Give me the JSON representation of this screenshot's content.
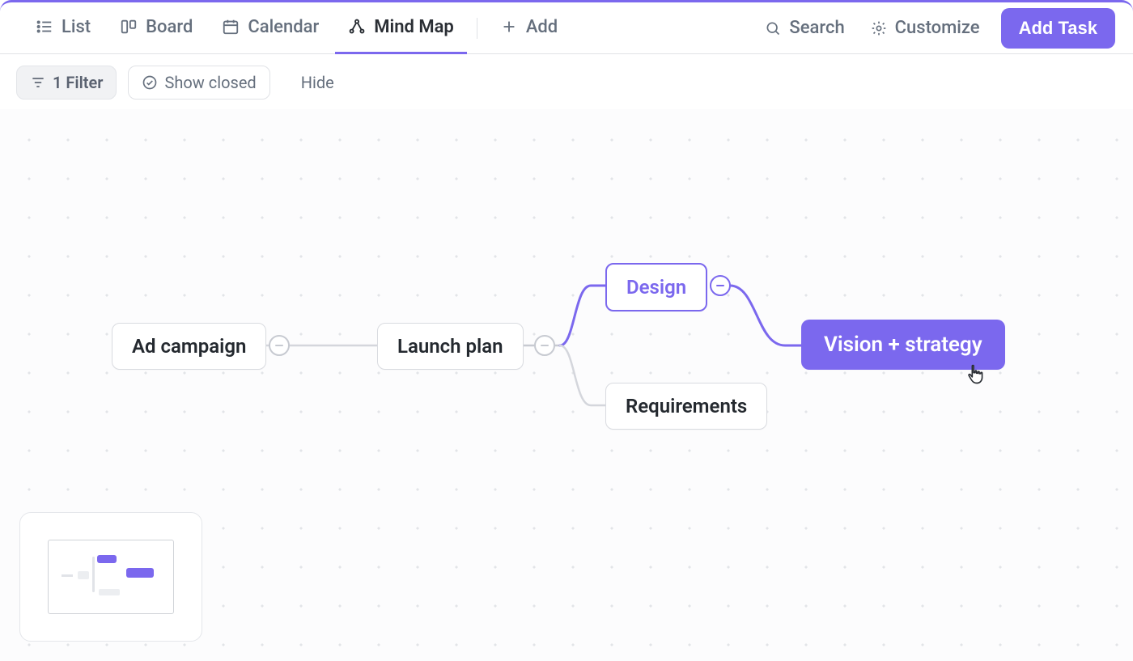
{
  "tabs": {
    "list": {
      "label": "List"
    },
    "board": {
      "label": "Board"
    },
    "calendar": {
      "label": "Calendar"
    },
    "mind_map": {
      "label": "Mind Map"
    },
    "add": {
      "label": "Add"
    }
  },
  "toolbar_right": {
    "search": "Search",
    "customize": "Customize",
    "add_task": "Add Task"
  },
  "filters": {
    "filter_chip": "1 Filter",
    "show_closed": "Show closed",
    "hide": "Hide"
  },
  "nodes": {
    "ad_campaign": "Ad campaign",
    "launch_plan": "Launch plan",
    "design": "Design",
    "requirements": "Requirements",
    "vision": "Vision + strategy"
  }
}
